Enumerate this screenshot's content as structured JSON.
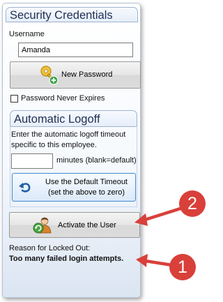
{
  "security": {
    "title": "Security Credentials",
    "username_label": "Username",
    "username_value": "Amanda",
    "new_password_label": "New Password",
    "never_expires_label": "Password Never Expires",
    "never_expires_checked": false
  },
  "logoff": {
    "title": "Automatic Logoff",
    "description": "Enter the automatic logoff timeout specific to this employee.",
    "timeout_value": "",
    "minutes_label": "minutes (blank=default)",
    "default_button_label": "Use the Default Timeout (set the above to zero)"
  },
  "activate": {
    "button_label": "Activate the User"
  },
  "locked": {
    "reason_label": "Reason for Locked Out:",
    "reason_value": "Too many failed login attempts."
  },
  "annotations": {
    "badge_1": "1",
    "badge_2": "2",
    "color": "#d9403a"
  },
  "icons": {
    "new_password": "key-add-icon",
    "default_timeout": "undo-arrow-icon",
    "activate": "user-refresh-icon"
  }
}
